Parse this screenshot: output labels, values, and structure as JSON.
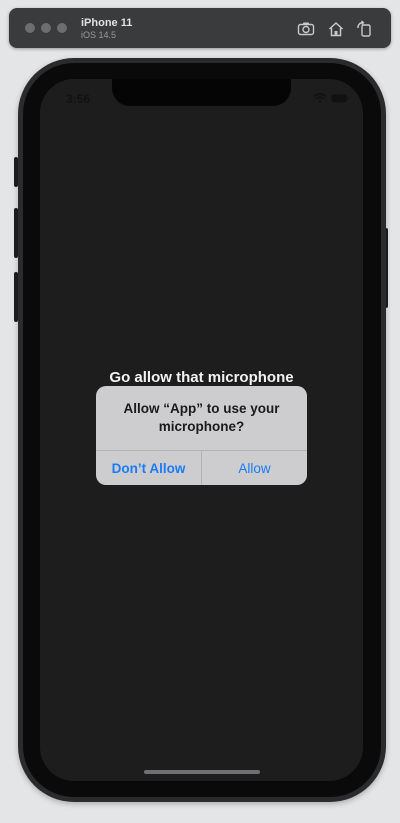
{
  "simulator": {
    "device_name": "iPhone 11",
    "os_version": "iOS 14.5"
  },
  "status_bar": {
    "time": "3:56"
  },
  "app": {
    "headline": "Go allow that microphone"
  },
  "alert": {
    "title": "Allow “App” to use your microphone?",
    "deny_label": "Don’t Allow",
    "allow_label": "Allow"
  },
  "colors": {
    "accent": "#1a7cf5",
    "screen_background": "#1d1d1d",
    "alert_background": "#cdcdcf"
  }
}
